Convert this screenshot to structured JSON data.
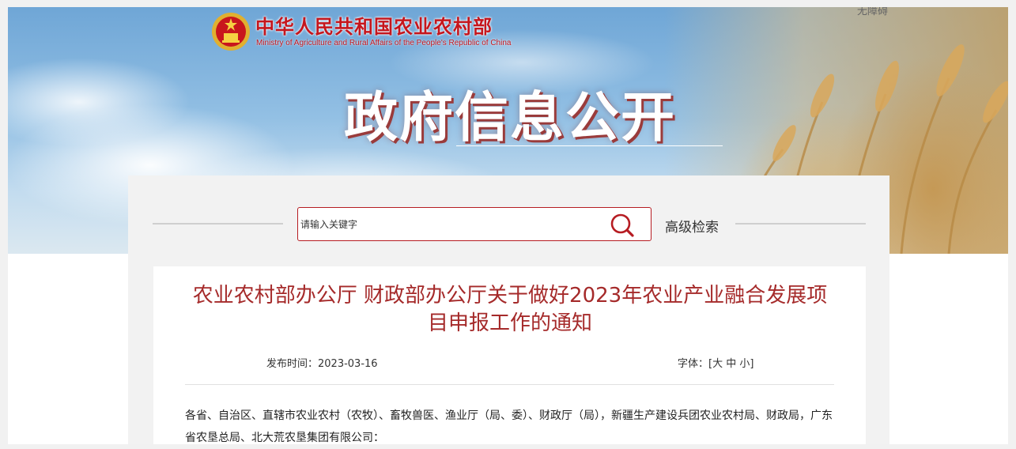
{
  "header": {
    "ministry_name_cn": "中华人民共和国农业农村部",
    "ministry_name_en": "Ministry of Agriculture and Rural Affairs of the People's Republic of China",
    "corner_link": "无障碍",
    "banner_title": "政府信息公开",
    "emblem_icon": "national-emblem-icon"
  },
  "search": {
    "placeholder": "请输入关键字",
    "icon": "search-icon",
    "advanced_label": "高级检索"
  },
  "article": {
    "title": "农业农村部办公厅 财政部办公厅关于做好2023年农业产业融合发展项目申报工作的通知",
    "date_label": "发布时间：",
    "date": "2023-03-16",
    "font_size": {
      "label": "字体：",
      "open": "[",
      "large": "大",
      "medium": "中",
      "small": "小",
      "close": "]"
    },
    "body": "各省、自治区、直辖市农业农村（农牧）、畜牧兽医、渔业厅（局、委）、财政厅（局），新疆生产建设兵团农业农村局、财政局，广东省农垦总局、北大荒农垦集团有限公司："
  },
  "colors": {
    "brand_red": "#c5161d",
    "title_red": "#a52a2a",
    "panel_bg": "#f2f2f2"
  }
}
